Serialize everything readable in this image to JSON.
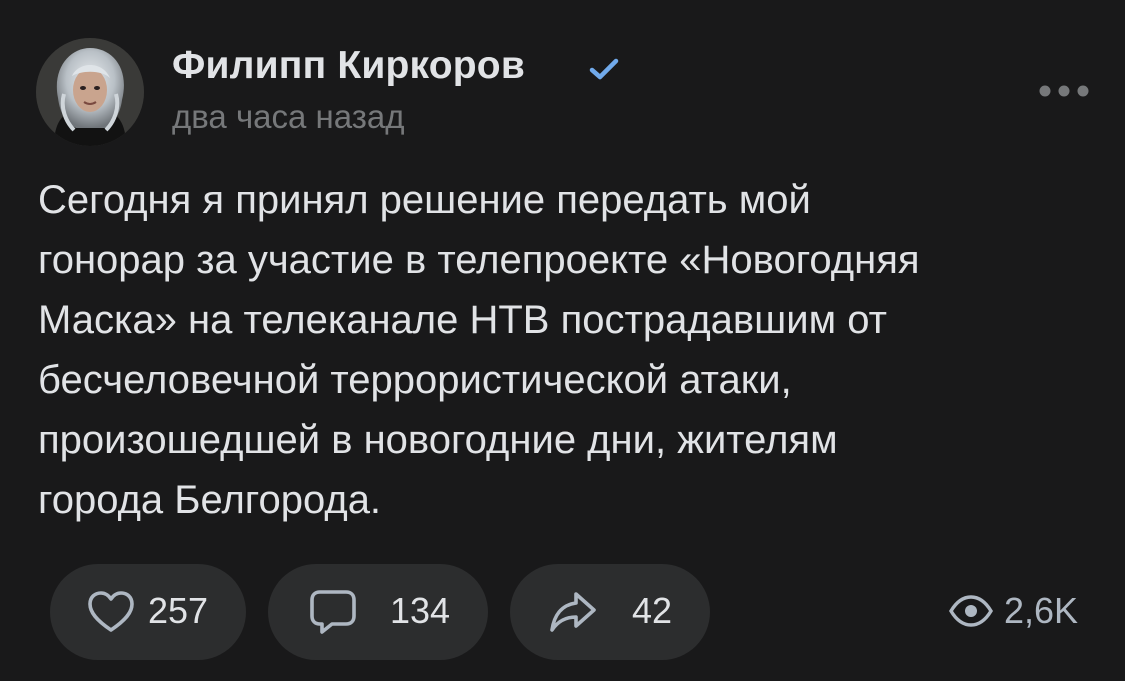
{
  "post": {
    "author": {
      "name": "Филипп Киркоров",
      "verified": true,
      "avatar_icon": "user-avatar-photo"
    },
    "timestamp": "два часа назад",
    "menu_icon": "more-dots-icon",
    "text_lines": [
      "Сегодня я принял решение передать мой",
      "гонорар за участие в телепроекте «Новогодняя",
      "Маска» на телеканале НТВ пострадавшим от",
      "бесчеловечной террористической атаки,",
      "произошедшей в новогодние дни, жителям",
      "города Белгорода."
    ],
    "actions": {
      "likes": {
        "icon": "heart-icon",
        "count": "257"
      },
      "comments": {
        "icon": "comment-icon",
        "count": "134"
      },
      "shares": {
        "icon": "share-icon",
        "count": "42"
      },
      "views": {
        "icon": "eye-icon",
        "count": "2,6K"
      }
    }
  },
  "colors": {
    "background": "#19191a",
    "button_background": "#2c2d2e",
    "text": "#e1e3e6",
    "secondary_text": "#76787a",
    "verified_accent": "#71aaeb"
  }
}
